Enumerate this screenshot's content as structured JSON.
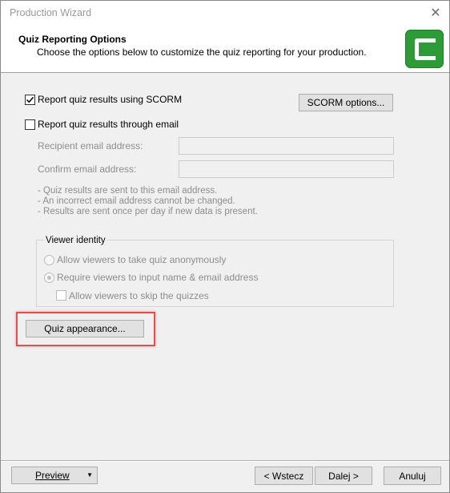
{
  "window": {
    "title": "Production Wizard"
  },
  "header": {
    "title": "Quiz Reporting Options",
    "subtitle": "Choose the options below to customize the quiz reporting for your production.",
    "logo_icon": "camtasia-logo-icon",
    "logo_color": "#2d9b38"
  },
  "scorm": {
    "label": "Report quiz results using SCORM",
    "checked": true,
    "options_button": "SCORM options..."
  },
  "email": {
    "label": "Report quiz results through email",
    "checked": false,
    "recipient_label": "Recipient email address:",
    "recipient_value": "",
    "confirm_label": "Confirm email address:",
    "confirm_value": "",
    "notes": [
      "-  Quiz results are sent to this email address.",
      "-  An incorrect email address cannot be changed.",
      "-  Results are sent once per day if new data is present."
    ]
  },
  "viewer_identity": {
    "legend": "Viewer identity",
    "anonymous_label": "Allow viewers to take quiz anonymously",
    "require_label": "Require viewers to input name & email address",
    "skip_label": "Allow viewers to skip the quizzes"
  },
  "quiz_appearance_button": "Quiz appearance...",
  "highlight_color": "#e05050",
  "footer": {
    "preview_button": "Preview",
    "back_button": "< Wstecz",
    "next_button": "Dalej >",
    "cancel_button": "Anuluj"
  }
}
